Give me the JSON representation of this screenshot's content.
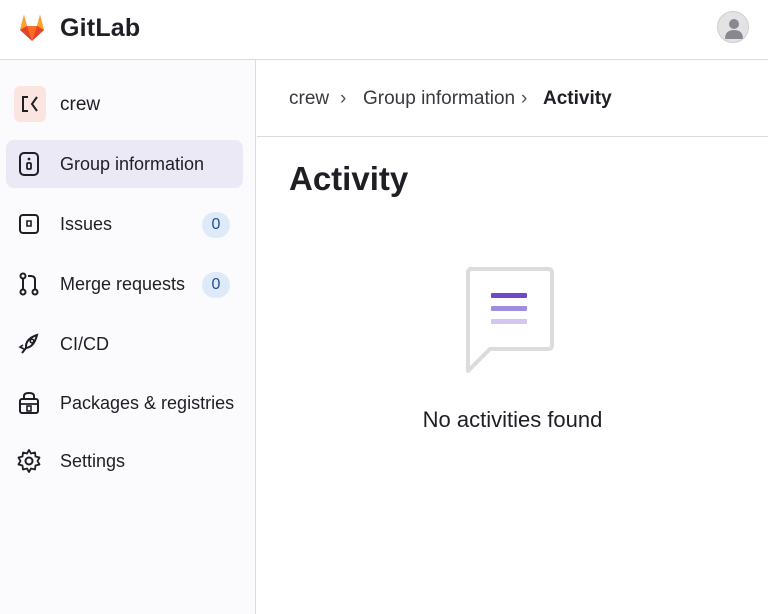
{
  "app": {
    "name": "GitLab"
  },
  "icons": {
    "logo": "gitlab-tanuki-logo",
    "avatar": "user-avatar",
    "group": "group-initial-icon",
    "group_information": "info-icon",
    "issues": "issues-icon",
    "merge_requests": "merge-request-icon",
    "ci_cd": "rocket-icon",
    "packages": "package-icon",
    "settings": "gear-icon",
    "empty_state": "speech-bubble-icon"
  },
  "colors": {
    "brand_orange": "#e24329",
    "brand_orange_light": "#fc6d26",
    "brand_yellow": "#fca326",
    "accent_purple": "#6e49cb",
    "active_bg": "#ebe9f6",
    "badge_bg": "#dfeaf8"
  },
  "sidebar": {
    "group_name": "crew",
    "items": [
      {
        "label": "Group information",
        "active": true
      },
      {
        "label": "Issues",
        "count": "0"
      },
      {
        "label": "Merge requests",
        "count": "0"
      },
      {
        "label": "CI/CD"
      },
      {
        "label": "Packages & registries"
      },
      {
        "label": "Settings"
      }
    ]
  },
  "breadcrumb": {
    "items": [
      "crew",
      "Group information",
      "Activity"
    ],
    "separator": "›"
  },
  "main": {
    "title": "Activity",
    "empty_message": "No activities found"
  }
}
